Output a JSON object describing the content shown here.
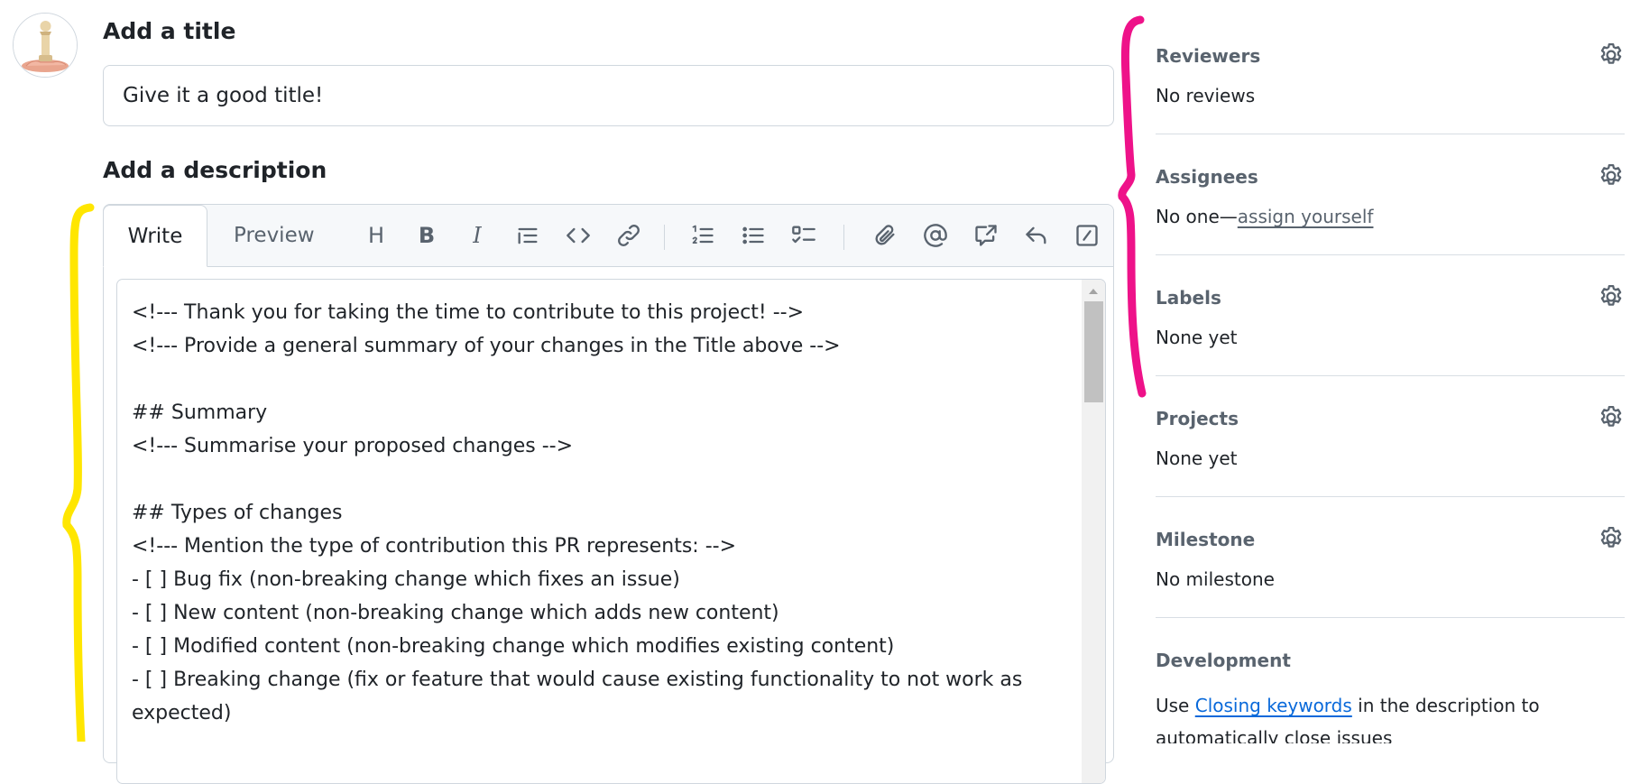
{
  "title_section": {
    "heading": "Add a title",
    "placeholder": "Give it a good title!"
  },
  "description_section": {
    "heading": "Add a description",
    "tabs": {
      "write": "Write",
      "preview": "Preview"
    },
    "toolbar": {
      "heading": "H",
      "bold": "B",
      "italic": "I"
    },
    "lines": [
      "<!--- Thank you for taking the time to contribute to this project! -->",
      "<!--- Provide a general summary of your changes in the Title above -->",
      "",
      "## Summary",
      "<!--- Summarise your proposed changes -->",
      "",
      "## Types of changes",
      "<!--- Mention the type of contribution this PR represents: -->",
      "- [ ] Bug fix (non-breaking change which fixes an issue)",
      "- [ ] New content (non-breaking change which adds new content)",
      "- [ ] Modified content (non-breaking change which modifies existing content)",
      "- [ ] Breaking change (fix or feature that would cause existing functionality to not work as",
      "expected)"
    ]
  },
  "sidebar": {
    "reviewers": {
      "title": "Reviewers",
      "value": "No reviews"
    },
    "assignees": {
      "title": "Assignees",
      "value_prefix": "No one—",
      "value_link": "assign yourself"
    },
    "labels": {
      "title": "Labels",
      "value": "None yet"
    },
    "projects": {
      "title": "Projects",
      "value": "None yet"
    },
    "milestone": {
      "title": "Milestone",
      "value": "No milestone"
    },
    "development": {
      "title": "Development",
      "text_prefix": "Use ",
      "text_link": "Closing keywords",
      "text_suffix": " in the description to",
      "text_line2": "automatically close issues"
    }
  },
  "colors": {
    "annotation_yellow": "#ffe600",
    "annotation_pink": "#ee1289",
    "link_blue": "#0969da",
    "muted_text": "#59636e",
    "border": "#d0d7de"
  },
  "icons": [
    "user-avatar",
    "heading-icon",
    "bold-icon",
    "italic-icon",
    "quote-icon",
    "code-icon",
    "link-icon",
    "ordered-list-icon",
    "unordered-list-icon",
    "task-list-icon",
    "attach-icon",
    "mention-icon",
    "reference-icon",
    "reply-icon",
    "slash-command-icon",
    "gear-icon"
  ]
}
